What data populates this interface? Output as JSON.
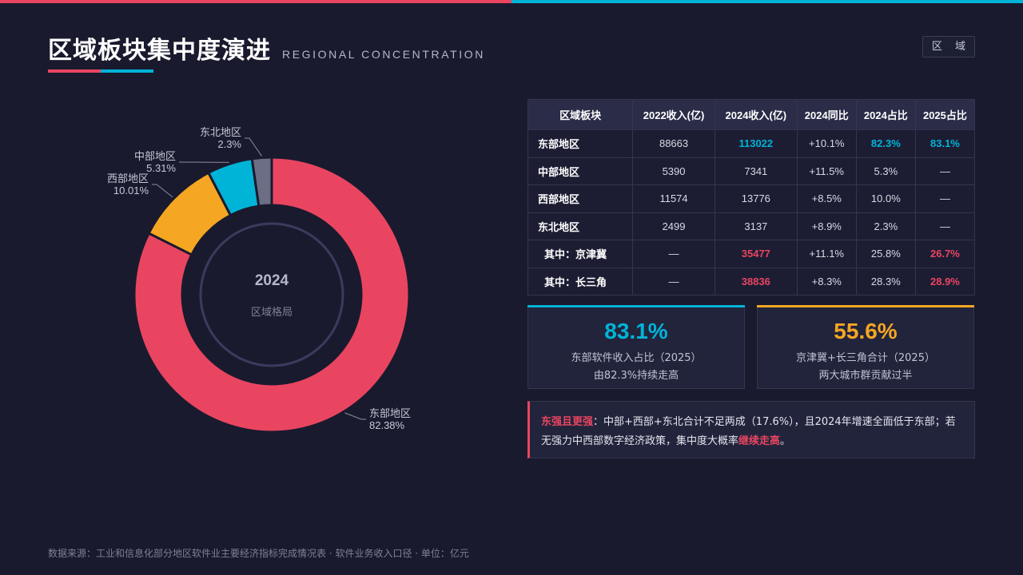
{
  "header": {
    "title": "区域板块集中度演进",
    "subtitle": "REGIONAL CONCENTRATION",
    "tag": "区 域"
  },
  "colors": {
    "east": "#e94560",
    "west": "#f5a623",
    "central": "#00b4d8",
    "northeast": "#6b6e85",
    "background": "#1a1a2e"
  },
  "chart_data": {
    "type": "pie",
    "donut": true,
    "center_label": "2024",
    "center_sublabel": "区域格局",
    "slices": [
      {
        "name": "东部地区",
        "value": 82.38,
        "label": "82.38%",
        "color": "#e94560"
      },
      {
        "name": "西部地区",
        "value": 10.01,
        "label": "10.01%",
        "color": "#f5a623"
      },
      {
        "name": "中部地区",
        "value": 5.31,
        "label": "5.31%",
        "color": "#00b4d8"
      },
      {
        "name": "东北地区",
        "value": 2.3,
        "label": "2.3%",
        "color": "#6b6e85"
      }
    ]
  },
  "table": {
    "headers": [
      "区域板块",
      "2022收入(亿)",
      "2024收入(亿)",
      "2024同比",
      "2024占比",
      "2025占比"
    ],
    "rows": [
      {
        "indent": false,
        "cells": [
          "东部地区",
          "88663",
          "113022",
          "+10.1%",
          "82.3%",
          "83.1%"
        ],
        "hl": [
          "",
          "",
          "cyan",
          "",
          "cyan",
          "cyan"
        ]
      },
      {
        "indent": false,
        "cells": [
          "中部地区",
          "5390",
          "7341",
          "+11.5%",
          "5.3%",
          "—"
        ],
        "hl": [
          "",
          "",
          "",
          "",
          "",
          ""
        ]
      },
      {
        "indent": false,
        "cells": [
          "西部地区",
          "11574",
          "13776",
          "+8.5%",
          "10.0%",
          "—"
        ],
        "hl": [
          "",
          "",
          "",
          "",
          "",
          ""
        ]
      },
      {
        "indent": false,
        "cells": [
          "东北地区",
          "2499",
          "3137",
          "+8.9%",
          "2.3%",
          "—"
        ],
        "hl": [
          "",
          "",
          "",
          "",
          "",
          ""
        ]
      },
      {
        "indent": true,
        "cells": [
          "其中：京津冀",
          "—",
          "35477",
          "+11.1%",
          "25.8%",
          "26.7%"
        ],
        "hl": [
          "",
          "",
          "pink",
          "",
          "",
          "pink"
        ]
      },
      {
        "indent": true,
        "cells": [
          "其中：长三角",
          "—",
          "38836",
          "+8.3%",
          "28.3%",
          "28.9%"
        ],
        "hl": [
          "",
          "",
          "pink",
          "",
          "",
          "pink"
        ]
      }
    ]
  },
  "kpis": [
    {
      "value": "83.1%",
      "line1": "东部软件收入占比（2025）",
      "line2": "由82.3%持续走高",
      "color": "#00b4d8"
    },
    {
      "value": "55.6%",
      "line1": "京津冀+长三角合计（2025）",
      "line2": "两大城市群贡献过半",
      "color": "#f5a623"
    }
  ],
  "note": {
    "lead": "东强且更强",
    "body": "：中部+西部+东北合计不足两成（17.6%），且2024年增速全面低于东部；若无强力中西部数字经济政策，集中度大概率",
    "emph": "继续走高",
    "end": "。"
  },
  "footer": {
    "source": "数据来源：工业和信息化部分地区软件业主要经济指标完成情况表 · 软件业务收入口径 · 单位：亿元"
  }
}
